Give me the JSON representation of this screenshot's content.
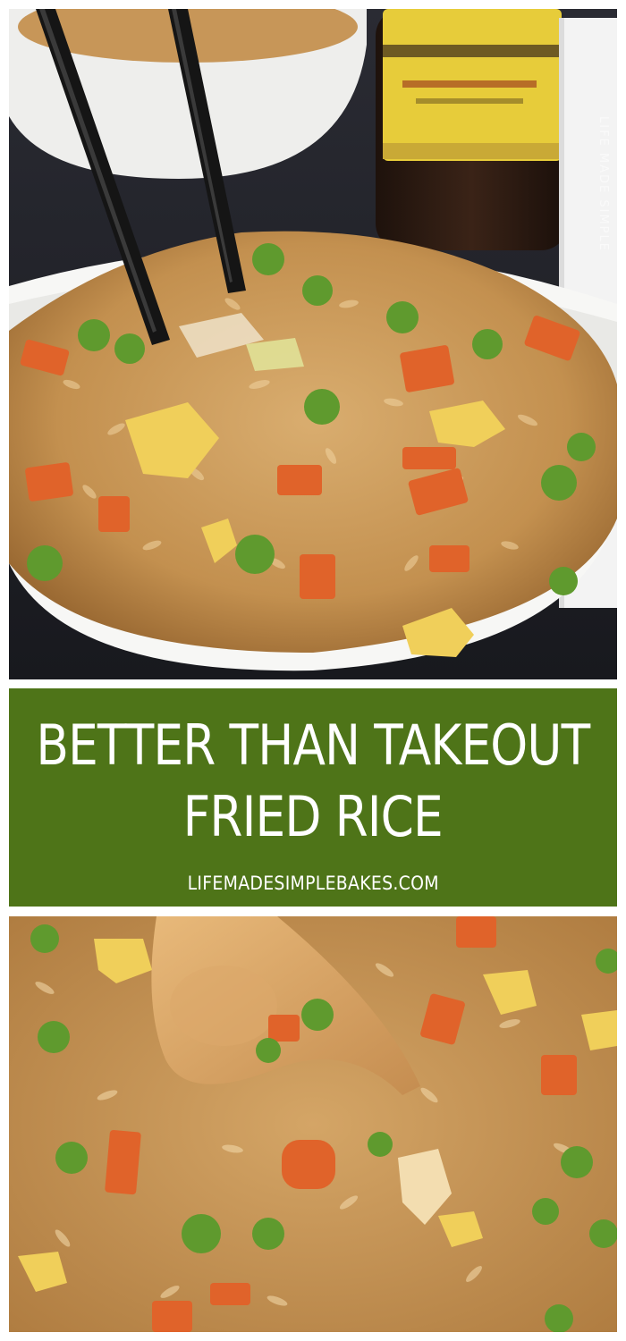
{
  "title_lines": [
    "BETTER THAN TAKEOUT",
    "FRIED RICE"
  ],
  "website": "LIFEMADESIMPLEBAKES.COM",
  "watermark": "LIFE MADE SIMPLE",
  "colors": {
    "banner_green": "#4e7418",
    "background_dark": "#1f2026",
    "bowl_white": "#f7f7f5",
    "rice": "#c99a5c",
    "carrot": "#e0632a",
    "pea": "#5f9a2e",
    "egg": "#f0cf5a",
    "chopsticks": "#151515",
    "wooden_spoon": "#d9a86a"
  },
  "icons": {
    "chopsticks": "chopsticks-icon",
    "bowl": "bowl-icon",
    "spoon": "wooden-spoon-icon"
  }
}
